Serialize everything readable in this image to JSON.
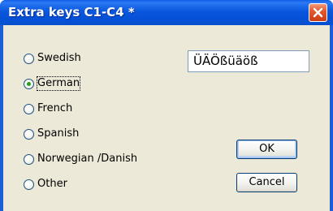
{
  "window": {
    "title": "Extra keys C1-C4 *"
  },
  "icons": {
    "close": "close-icon"
  },
  "colors": {
    "titlebar": "#0552d8",
    "close_button": "#e15a2f",
    "dialog_background": "#ece9d8",
    "radio_selected_dot": "#21a121"
  },
  "languages": {
    "selected": "German",
    "options": [
      {
        "label": "Swedish",
        "checked": false
      },
      {
        "label": "German",
        "checked": true
      },
      {
        "label": "French",
        "checked": false
      },
      {
        "label": "Spanish",
        "checked": false
      },
      {
        "label": "Norwegian /Danish",
        "checked": false
      },
      {
        "label": "Other",
        "checked": false
      }
    ]
  },
  "characters_field": {
    "value": "ÜÄÖßüäöß"
  },
  "buttons": {
    "ok": "OK",
    "cancel": "Cancel"
  }
}
